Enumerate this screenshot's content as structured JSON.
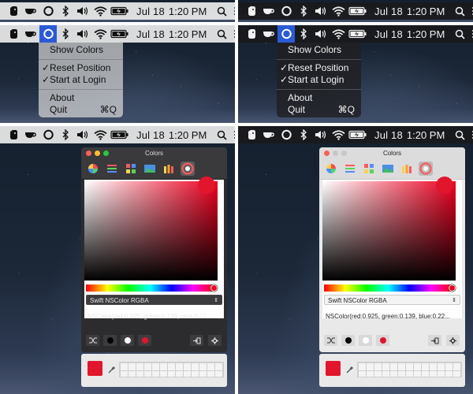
{
  "menubar": {
    "date": "Jul 18",
    "time": "1:20 PM",
    "icons": [
      "evernote-icon",
      "coffee-cup-icon",
      "color-picker-app-icon",
      "bluetooth-icon",
      "volume-icon",
      "wifi-icon",
      "battery-charging-icon",
      "search-icon",
      "list-icon"
    ]
  },
  "menu": {
    "items": [
      {
        "label": "Show Colors",
        "checked": false,
        "shortcut": ""
      },
      {
        "label": "Reset Position",
        "checked": true,
        "shortcut": ""
      },
      {
        "label": "Start at Login",
        "checked": true,
        "shortcut": ""
      },
      {
        "label": "About",
        "checked": false,
        "shortcut": ""
      },
      {
        "label": "Quit",
        "checked": false,
        "shortcut": "⌘Q"
      }
    ],
    "check_glyph": "✓"
  },
  "color_panel": {
    "title": "Colors",
    "format_select": "Swift NSColor RGBA",
    "format_arrow": "⇕",
    "code_output": "NSColor(red:0.925, green:0.139, blue:0.22...",
    "current_color": "#e1162d",
    "toolbar_tabs": [
      "color-wheel-icon",
      "color-sliders-icon",
      "color-palettes-icon",
      "image-palettes-icon",
      "crayons-icon",
      "color-picker-plugin-icon"
    ],
    "selected_tab_index": 5,
    "quick_swatches": [
      "#000000",
      "#ffffff",
      "#e1162d"
    ],
    "swatch_count": 26
  },
  "colors": {
    "accent_active": "#2a5bd7",
    "red": "#e1162d",
    "close": "#fe5f57",
    "minimize": "#febc2e",
    "zoom": "#28c840",
    "inactive_light": "#c7c7c7"
  }
}
